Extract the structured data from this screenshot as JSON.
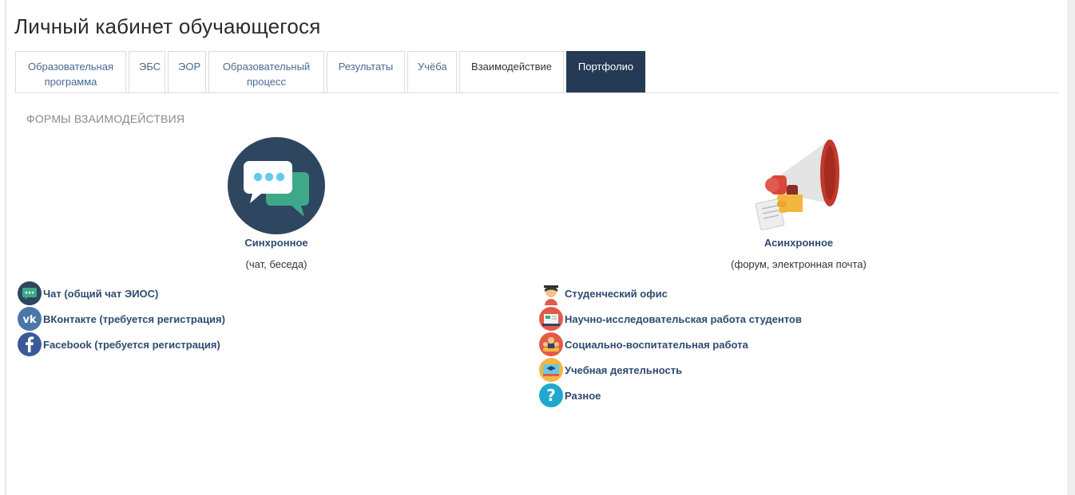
{
  "page_title": "Личный кабинет обучающегося",
  "tabs": [
    {
      "label": "Образовательная\nпрограмма"
    },
    {
      "label": "ЭБС"
    },
    {
      "label": "ЭОР"
    },
    {
      "label": "Образовательный\nпроцесс"
    },
    {
      "label": "Результаты"
    },
    {
      "label": "Учёба"
    },
    {
      "label": "Взаимодействие"
    },
    {
      "label": "Портфолио",
      "active": true
    }
  ],
  "section_title": "ФОРМЫ ВЗАИМОДЕЙСТВИЯ",
  "sync": {
    "title": "Синхронное",
    "subtitle": "(чат, беседа)",
    "icon": "chat-bubbles-icon",
    "links": [
      {
        "label": "Чат (общий чат ЭИОС)",
        "icon": "chat-icon"
      },
      {
        "label": "ВКонтакте (требуется регистрация)",
        "icon": "vk-icon"
      },
      {
        "label": "Facebook (требуется регистрация)",
        "icon": "facebook-icon"
      }
    ]
  },
  "async": {
    "title": "Асинхронное",
    "subtitle": "(форум, электронная почта)",
    "icon": "megaphone-icon",
    "links": [
      {
        "label": "Студенческий офис",
        "icon": "student-office-icon"
      },
      {
        "label": "Научно-исследовательская работа студентов",
        "icon": "research-icon"
      },
      {
        "label": "Социально-воспитательная работа",
        "icon": "social-work-icon"
      },
      {
        "label": "Учебная деятельность",
        "icon": "study-icon"
      },
      {
        "label": "Разное",
        "icon": "question-icon"
      }
    ]
  },
  "colors": {
    "active_tab": "#253b55",
    "link": "#2e4a72",
    "tab_link": "#4a6b8f"
  }
}
